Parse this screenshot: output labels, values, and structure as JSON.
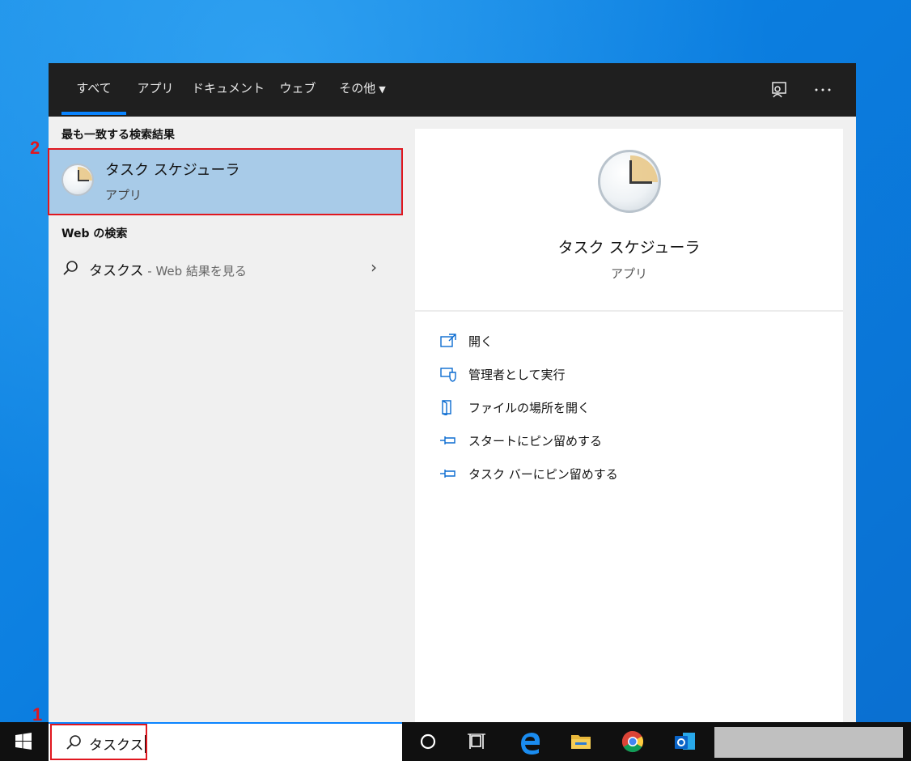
{
  "tabs": {
    "all": "すべて",
    "apps": "アプリ",
    "documents": "ドキュメント",
    "web": "ウェブ",
    "more": "その他"
  },
  "left": {
    "best_match_heading": "最も一致する検索結果",
    "best_match_title": "タスク スケジューラ",
    "best_match_sub": "アプリ",
    "web_heading": "Web の検索",
    "web_query": "タスクス",
    "web_suffix": " - Web 結果を見る"
  },
  "right": {
    "title": "タスク スケジューラ",
    "subtitle": "アプリ",
    "actions": [
      {
        "label": "開く",
        "icon": "open-icon"
      },
      {
        "label": "管理者として実行",
        "icon": "shield-icon"
      },
      {
        "label": "ファイルの場所を開く",
        "icon": "file-location-icon"
      },
      {
        "label": "スタートにピン留めする",
        "icon": "pin-icon"
      },
      {
        "label": "タスク バーにピン留めする",
        "icon": "pin-icon"
      }
    ]
  },
  "taskbar": {
    "search_value": "タスクス"
  },
  "annotations": {
    "step1": "1",
    "step2": "2"
  }
}
